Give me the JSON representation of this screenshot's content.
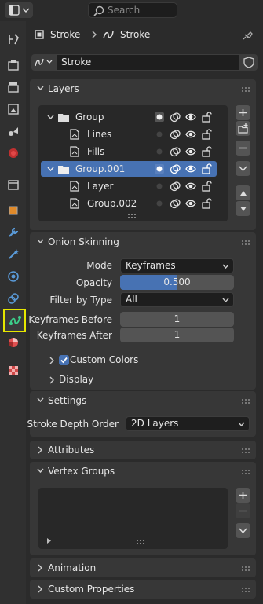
{
  "search": {
    "placeholder": "Search"
  },
  "breadcrumb": {
    "object": "Stroke",
    "data": "Stroke"
  },
  "datablock": {
    "name": "Stroke"
  },
  "layers": {
    "title": "Layers",
    "rows": [
      {
        "name": "Group"
      },
      {
        "name": "Lines"
      },
      {
        "name": "Fills"
      },
      {
        "name": "Group.001"
      },
      {
        "name": "Layer"
      },
      {
        "name": "Group.002"
      }
    ]
  },
  "onion": {
    "title": "Onion Skinning",
    "mode_label": "Mode",
    "mode_value": "Keyframes",
    "opacity_label": "Opacity",
    "opacity_value": "0.500",
    "opacity_fraction": 0.5,
    "filter_label": "Filter by Type",
    "filter_value": "All",
    "kf_before_label": "Keyframes Before",
    "kf_before_value": "1",
    "kf_after_label": "Keyframes After",
    "kf_after_value": "1",
    "custom_colors_label": "Custom Colors",
    "custom_colors_checked": true,
    "display_label": "Display"
  },
  "settings": {
    "title": "Settings",
    "depth_label": "Stroke Depth Order",
    "depth_value": "2D Layers"
  },
  "attributes": {
    "title": "Attributes"
  },
  "vertex_groups": {
    "title": "Vertex Groups"
  },
  "animation": {
    "title": "Animation"
  },
  "custom_properties": {
    "title": "Custom Properties"
  },
  "colors": {
    "accent": "#4772b3",
    "highlight": "#e6e600"
  }
}
